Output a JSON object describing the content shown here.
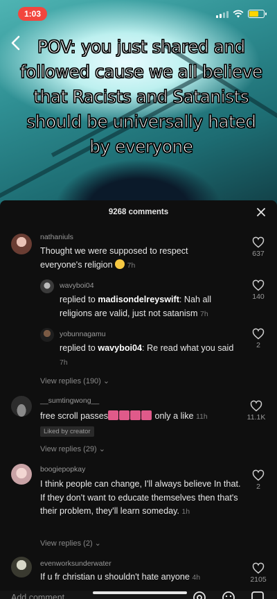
{
  "status_bar": {
    "recording_label": "1:03",
    "recording_color": "#f2463e",
    "battery_color": "#ffd400"
  },
  "video": {
    "overlay_caption": "POV: you just shared and followed cause we all believe that Racists and Satanists should be universally hated by everyone",
    "back_icon": "chevron-left-icon"
  },
  "comments_sheet": {
    "count_label": "9268 comments",
    "close_icon": "close-icon",
    "comments": [
      {
        "username": "nathaniuls",
        "text": "Thought we were supposed to respect everyone's religion",
        "emoji": "worried-face",
        "time": "7h",
        "likes": "637"
      },
      {
        "username": "wavyboi04",
        "prefix": "replied to ",
        "mention": "madisondelreyswift",
        "text": ": Nah all religions are valid, just not satanism",
        "time": "7h",
        "likes": "140"
      },
      {
        "username": "yobunnagamu",
        "prefix": "replied to ",
        "mention": "wavyboi04",
        "text": ": Re read what you said",
        "time": "7h",
        "likes": "2"
      },
      {
        "username": "__sumtingwong__",
        "text_before": "free scroll passes",
        "text_after": "only a like",
        "time": "11h",
        "likes": "11.1K",
        "badge": "Liked by creator"
      },
      {
        "username": "boogiepopkay",
        "text": "I think people can change, I'll always believe In that. If they don't want to educate themselves then that's their problem, they'll learn someday.",
        "time": "1h",
        "likes": "2"
      },
      {
        "username": "evenworksunderwater",
        "text": "If u fr christian u shouldn't hate anyone",
        "time": "4h",
        "likes": "2105"
      }
    ],
    "view_replies": [
      "View replies (190)",
      "View replies (29)",
      "View replies (2)"
    ]
  },
  "input_bar": {
    "placeholder": "Add comment...",
    "icons": [
      "at-icon",
      "emoji-icon",
      "gif-icon"
    ]
  }
}
